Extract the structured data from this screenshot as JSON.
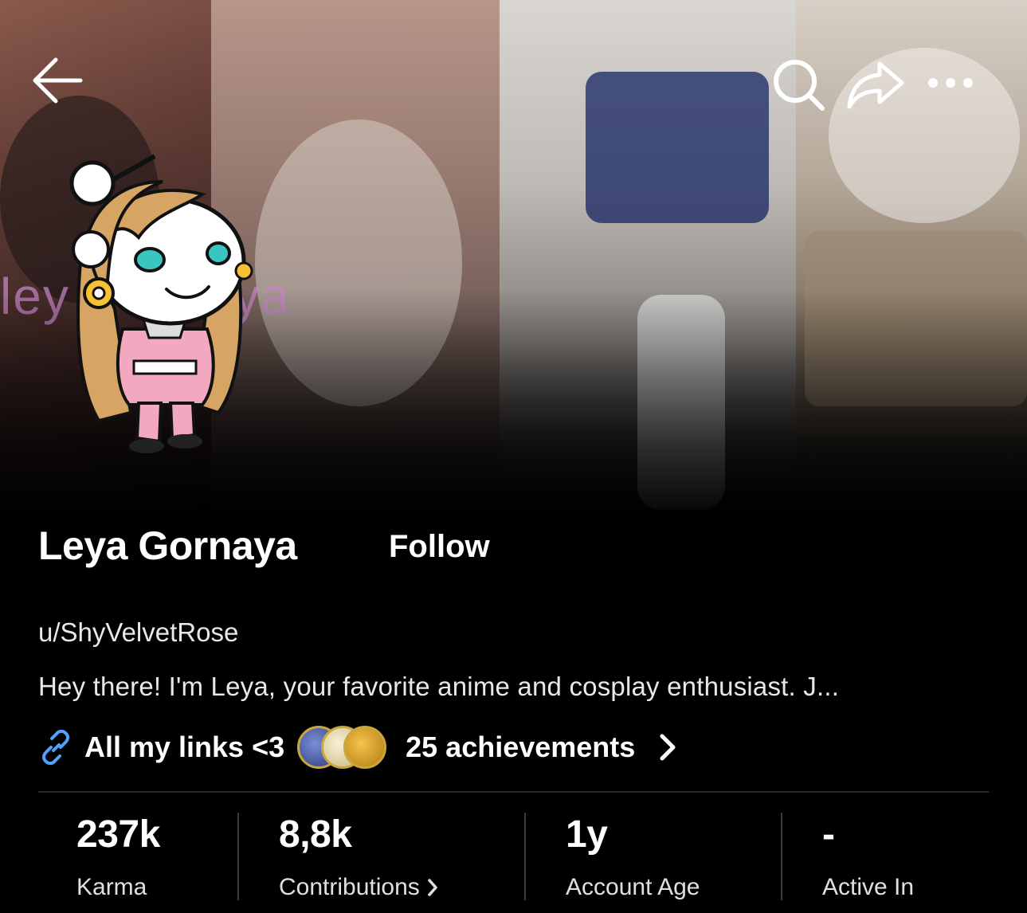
{
  "banner": {
    "watermark_left": "ley",
    "watermark_right": "aya"
  },
  "topbar": {
    "back_icon": "arrow-left-icon",
    "search_icon": "search-icon",
    "share_icon": "share-icon",
    "more_icon": "more-dots-icon"
  },
  "profile": {
    "display_name": "Leya Gornaya",
    "follow_label": "Follow",
    "username": "u/ShyVelvetRose",
    "bio": "Hey there! I'm Leya, your favorite anime and cosplay enthusiast. J...",
    "links_label": "All my links <3",
    "achievements_label": "25 achievements"
  },
  "stats": [
    {
      "value": "237k",
      "label": "Karma"
    },
    {
      "value": "8,8k",
      "label": "Contributions"
    },
    {
      "value": "1y",
      "label": "Account Age"
    },
    {
      "value": "-",
      "label": "Active In"
    }
  ],
  "colors": {
    "background": "#000000",
    "link_icon": "#4fa3ff",
    "avatar_pink": "#f2a9c0",
    "avatar_hair": "#d6a463",
    "avatar_eyes": "#39c6c0"
  }
}
